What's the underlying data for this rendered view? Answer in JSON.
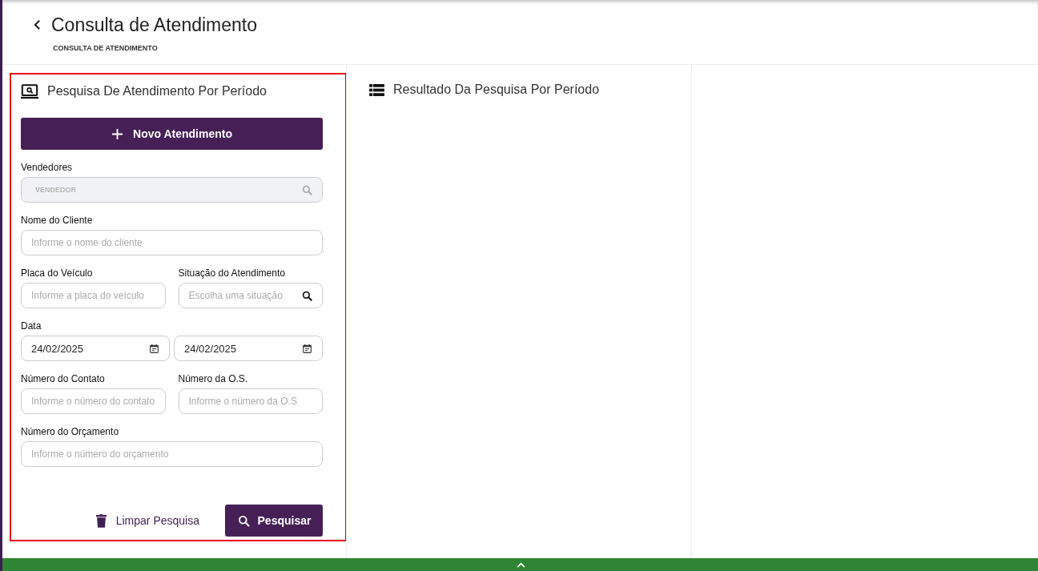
{
  "header": {
    "title": "Consulta de Atendimento",
    "subtitle": "CONSULTA DE ATENDIMENTO"
  },
  "search_panel": {
    "title": "Pesquisa De Atendimento Por Período",
    "new_button": "Novo Atendimento",
    "rows": [
      {
        "fields": [
          {
            "label": "Vendedores",
            "kind": "search",
            "placeholder": "VENDEDOR",
            "disabled": true
          }
        ]
      },
      {
        "fields": [
          {
            "label": "Nome do Cliente",
            "kind": "text",
            "placeholder": "Informe o nome do cliente"
          }
        ]
      },
      {
        "fields": [
          {
            "label": "Placa do Veículo",
            "kind": "text",
            "placeholder": "Informe a placa do veículo"
          },
          {
            "label": "Situação do Atendimento",
            "kind": "search",
            "placeholder": "Escolha uma situação",
            "disabled": false
          }
        ]
      },
      {
        "label": "Data",
        "fields": [
          {
            "kind": "date",
            "value": "24/02/2025"
          },
          {
            "kind": "date",
            "value": "24/02/2025"
          }
        ]
      },
      {
        "fields": [
          {
            "label": "Número do Contato",
            "kind": "text",
            "placeholder": "Informe o número do contato"
          },
          {
            "label": "Número da O.S.",
            "kind": "text",
            "placeholder": "Informe o número da O.S"
          }
        ]
      },
      {
        "fields": [
          {
            "label": "Número do Orçamento",
            "kind": "text",
            "placeholder": "Informe o número do orçamento"
          }
        ]
      }
    ],
    "clear_button": "Limpar Pesquisa",
    "search_button": "Pesquisar"
  },
  "results_panel": {
    "title": "Resultado Da Pesquisa Por Período"
  }
}
